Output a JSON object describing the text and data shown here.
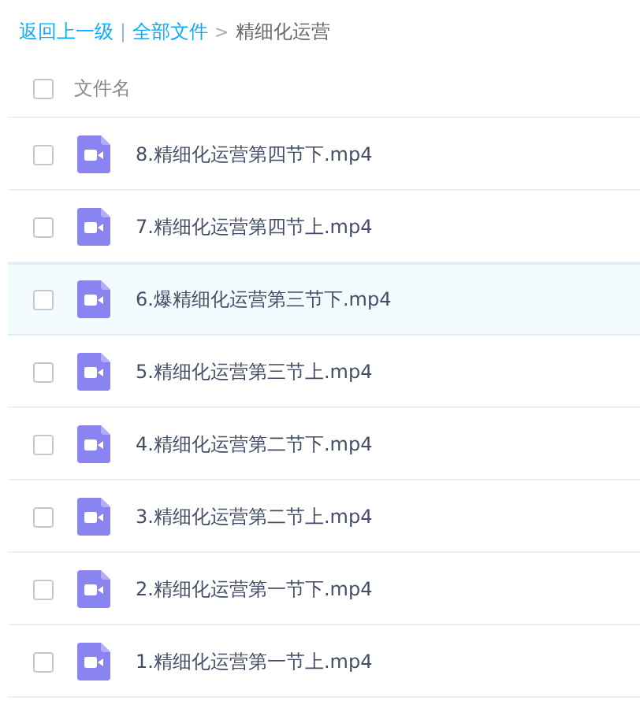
{
  "breadcrumb": {
    "back": "返回上一级",
    "separator": "|",
    "root": "全部文件",
    "arrow": ">",
    "current": "精细化运营"
  },
  "header": {
    "checked": false,
    "label": "文件名"
  },
  "files": [
    {
      "name": "8.精细化运营第四节下.mp4",
      "checked": false,
      "highlighted": false
    },
    {
      "name": "7.精细化运营第四节上.mp4",
      "checked": false,
      "highlighted": false
    },
    {
      "name": "6.爆精细化运营第三节下.mp4",
      "checked": false,
      "highlighted": true
    },
    {
      "name": "5.精细化运营第三节上.mp4",
      "checked": false,
      "highlighted": false
    },
    {
      "name": "4.精细化运营第二节下.mp4",
      "checked": false,
      "highlighted": false
    },
    {
      "name": "3.精细化运营第二节上.mp4",
      "checked": false,
      "highlighted": false
    },
    {
      "name": "2.精细化运营第一节下.mp4",
      "checked": false,
      "highlighted": false
    },
    {
      "name": "1.精细化运营第一节上.mp4",
      "checked": false,
      "highlighted": false
    }
  ]
}
